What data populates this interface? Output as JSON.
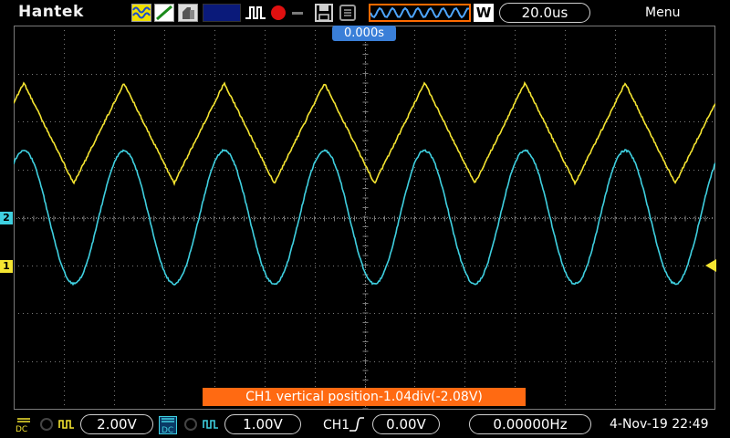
{
  "topbar": {
    "brand": "Hantek",
    "timebase_badge": "W",
    "timebase_value": "20.0us",
    "menu_label": "Menu",
    "icons": [
      "waveform-mode-icon",
      "vector-mode-icon",
      "persistence-icon",
      "blank-panel",
      "pulse-icon",
      "record-icon",
      "minus-icon",
      "save-disk-icon",
      "usb-icon",
      "timebase-waveform-icon"
    ]
  },
  "screen": {
    "trigger_time_label": "0.000s",
    "ch2_marker": "2",
    "ch1_marker": "1",
    "message": "CH1 vertical position-1.04div(-2.08V)"
  },
  "bottombar": {
    "ch1_coupling": "DC",
    "ch1_scale": "2.00V",
    "ch2_coupling": "DC",
    "ch2_scale": "1.00V",
    "trigger_source": "CH1",
    "trigger_level": "0.00V",
    "frequency": "0.00000Hz",
    "datetime": "4-Nov-19 22:49"
  },
  "colors": {
    "ch1": "#f5e531",
    "ch2": "#3fd0e0",
    "accent_orange": "#ff6a12",
    "trigger_label_bg": "#3a7fd8",
    "grid": "#7a7a7a"
  },
  "waveforms": {
    "ch1": {
      "shape": "triangle",
      "period_divisions": 2.0
    },
    "ch2": {
      "shape": "sine",
      "period_divisions": 2.0
    }
  }
}
